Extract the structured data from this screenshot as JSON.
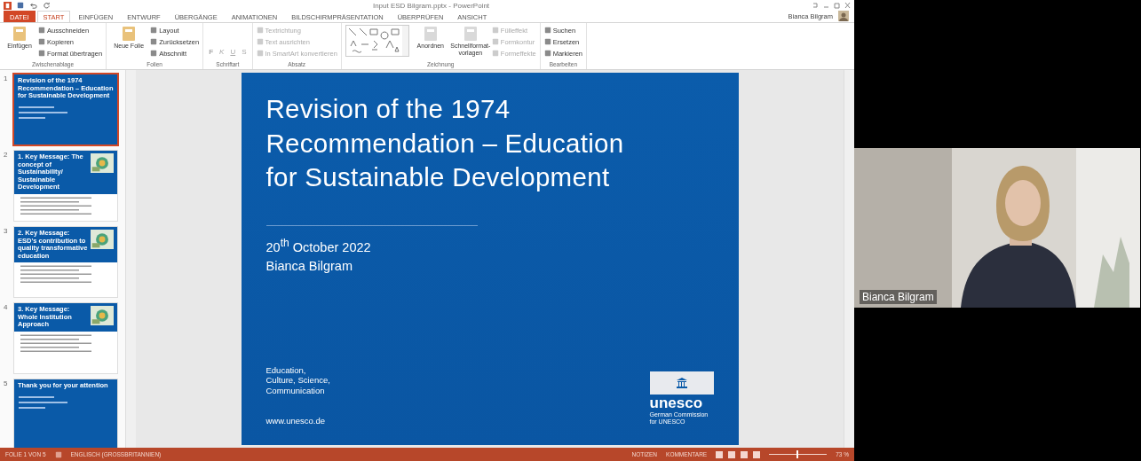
{
  "window": {
    "title": "Input ESD Bilgram.pptx - PowerPoint",
    "user": "Bianca Bilgram"
  },
  "tabs": [
    {
      "label": "DATEI",
      "kind": "file",
      "selected": false
    },
    {
      "label": "START",
      "kind": "tab",
      "selected": true
    },
    {
      "label": "EINFÜGEN",
      "kind": "tab",
      "selected": false
    },
    {
      "label": "ENTWURF",
      "kind": "tab",
      "selected": false
    },
    {
      "label": "ÜBERGÄNGE",
      "kind": "tab",
      "selected": false
    },
    {
      "label": "ANIMATIONEN",
      "kind": "tab",
      "selected": false
    },
    {
      "label": "BILDSCHIRMPRÄSENTATION",
      "kind": "tab",
      "selected": false
    },
    {
      "label": "ÜBERPRÜFEN",
      "kind": "tab",
      "selected": false
    },
    {
      "label": "ANSICHT",
      "kind": "tab",
      "selected": false
    }
  ],
  "ribbon_groups": [
    {
      "label": "Zwischenablage",
      "items": [
        {
          "label": "Einfügen",
          "kind": "large",
          "disabled": false
        },
        {
          "label": "Ausschneiden",
          "kind": "small",
          "disabled": false
        },
        {
          "label": "Kopieren",
          "kind": "small",
          "disabled": false
        },
        {
          "label": "Format übertragen",
          "kind": "small",
          "disabled": false
        }
      ]
    },
    {
      "label": "Folien",
      "items": [
        {
          "label": "Neue Folie",
          "kind": "large",
          "disabled": false
        },
        {
          "label": "Layout",
          "kind": "small",
          "disabled": false
        },
        {
          "label": "Zurücksetzen",
          "kind": "small",
          "disabled": false
        },
        {
          "label": "Abschnitt",
          "kind": "small",
          "disabled": false
        }
      ]
    },
    {
      "label": "Schriftart",
      "items": [
        {
          "label": "F",
          "kind": "format",
          "disabled": true
        },
        {
          "label": "K",
          "kind": "format",
          "disabled": true
        },
        {
          "label": "U",
          "kind": "format",
          "disabled": true
        },
        {
          "label": "S",
          "kind": "format",
          "disabled": true
        }
      ]
    },
    {
      "label": "Absatz",
      "items": [
        {
          "label": "Textrichtung",
          "kind": "small",
          "disabled": true
        },
        {
          "label": "Text ausrichten",
          "kind": "small",
          "disabled": true
        },
        {
          "label": "In SmartArt konvertieren",
          "kind": "small",
          "disabled": true
        }
      ]
    },
    {
      "label": "Zeichnung",
      "items": [
        {
          "kind": "shapes",
          "disabled": false
        },
        {
          "label": "Anordnen",
          "kind": "large",
          "disabled": false
        },
        {
          "label": "Schnellformat-vorlagen",
          "kind": "large",
          "disabled": false
        },
        {
          "label": "Fülleffekt",
          "kind": "small",
          "disabled": true
        },
        {
          "label": "Formkontur",
          "kind": "small",
          "disabled": true
        },
        {
          "label": "Formeffekte",
          "kind": "small",
          "disabled": true
        }
      ]
    },
    {
      "label": "Bearbeiten",
      "items": [
        {
          "label": "Suchen",
          "kind": "small",
          "disabled": false
        },
        {
          "label": "Ersetzen",
          "kind": "small",
          "disabled": false
        },
        {
          "label": "Markieren",
          "kind": "small",
          "disabled": false
        }
      ]
    }
  ],
  "thumbnails": [
    {
      "number": "1",
      "kind": "title",
      "selected": true,
      "title": "Revision of the 1974 Recommendation – Education for Sustainable Development"
    },
    {
      "number": "2",
      "kind": "content",
      "selected": false,
      "title": "1. Key Message: The concept of Sustainability/ Sustainable Development"
    },
    {
      "number": "3",
      "kind": "content",
      "selected": false,
      "title": "2. Key Message: ESD's contribution to quality transformative education"
    },
    {
      "number": "4",
      "kind": "content",
      "selected": false,
      "title": "3. Key Message: Whole Institution Approach"
    },
    {
      "number": "5",
      "kind": "closing",
      "selected": false,
      "title": "Thank you for your attention"
    }
  ],
  "slide": {
    "title": "Revision of the 1974 Recommendation – Education for Sustainable Development",
    "date": "20$^{th}$ October 2022",
    "author": "Bianca Bilgram",
    "footer": [
      "Education,",
      "Culture, Science,",
      "Communication"
    ],
    "url": "www.unesco.de",
    "logo": {
      "name": "unesco",
      "subtitle": [
        "German Commission",
        "for UNESCO"
      ]
    }
  },
  "status_bar": {
    "slide": "FOLIE 1 VON 5",
    "language": "ENGLISCH (GROSSBRITANNIEN)",
    "notes": "NOTIZEN",
    "comments": "KOMMENTARE",
    "zoom": {
      "level": 0.47,
      "reading": "73 %"
    }
  },
  "video": {
    "name": "Bianca Bilgram"
  }
}
